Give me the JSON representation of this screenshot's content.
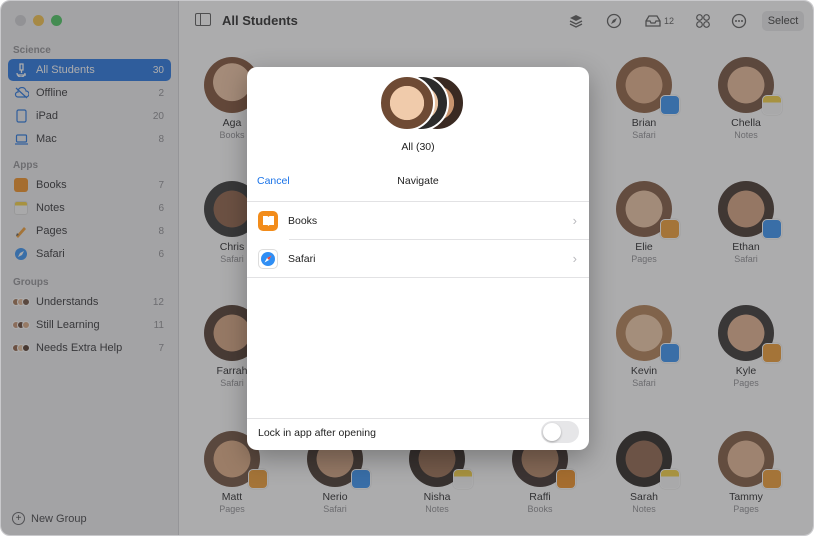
{
  "window": {
    "title": "All Students"
  },
  "sidebar": {
    "sections": [
      {
        "label": "Science"
      },
      {
        "label": "Apps"
      },
      {
        "label": "Groups"
      }
    ],
    "science": [
      {
        "label": "All Students",
        "count": "30",
        "icon": "microscope-icon",
        "selected": true
      },
      {
        "label": "Offline",
        "count": "2",
        "icon": "cloud-offline-icon"
      },
      {
        "label": "iPad",
        "count": "20",
        "icon": "ipad-icon"
      },
      {
        "label": "Mac",
        "count": "8",
        "icon": "laptop-icon"
      }
    ],
    "apps": [
      {
        "label": "Books",
        "count": "7",
        "icon": "books-app-icon"
      },
      {
        "label": "Notes",
        "count": "6",
        "icon": "notes-app-icon"
      },
      {
        "label": "Pages",
        "count": "8",
        "icon": "pages-app-icon"
      },
      {
        "label": "Safari",
        "count": "6",
        "icon": "safari-app-icon"
      }
    ],
    "groups": [
      {
        "label": "Understands",
        "count": "12",
        "icon": "group-avatars-icon"
      },
      {
        "label": "Still Learning",
        "count": "11",
        "icon": "group-avatars-icon"
      },
      {
        "label": "Needs Extra Help",
        "count": "7",
        "icon": "group-avatars-icon"
      }
    ],
    "new_group": "New Group"
  },
  "toolbar": {
    "title": "All Students",
    "inbox_count": "12",
    "select_label": "Select"
  },
  "students": [
    {
      "name": "Aga",
      "app": "Books"
    },
    {
      "name": "Brian",
      "app": "Safari"
    },
    {
      "name": "Chella",
      "app": "Notes"
    },
    {
      "name": "Chris",
      "app": "Safari"
    },
    {
      "name": "Elie",
      "app": "Pages"
    },
    {
      "name": "Ethan",
      "app": "Safari"
    },
    {
      "name": "Farrah",
      "app": "Safari"
    },
    {
      "name": "Kevin",
      "app": "Safari"
    },
    {
      "name": "Kyle",
      "app": "Pages"
    },
    {
      "name": "Matt",
      "app": "Pages"
    },
    {
      "name": "Nerio",
      "app": "Safari"
    },
    {
      "name": "Nisha",
      "app": "Notes"
    },
    {
      "name": "Raffi",
      "app": "Books"
    },
    {
      "name": "Sarah",
      "app": "Notes"
    },
    {
      "name": "Tammy",
      "app": "Pages"
    }
  ],
  "modal": {
    "all_label": "All (30)",
    "cancel": "Cancel",
    "title": "Navigate",
    "apps": [
      {
        "label": "Books",
        "icon": "books-app-icon"
      },
      {
        "label": "Safari",
        "icon": "safari-app-icon"
      }
    ],
    "lock_label": "Lock in app after opening",
    "lock_enabled": false
  },
  "colors": {
    "accent": "#1c6fe0",
    "link": "#1a73e8",
    "books": "#f28c1b",
    "notes": "#f6cf3a",
    "pages": "#f19a2b",
    "safari": "#2f8ef4"
  }
}
